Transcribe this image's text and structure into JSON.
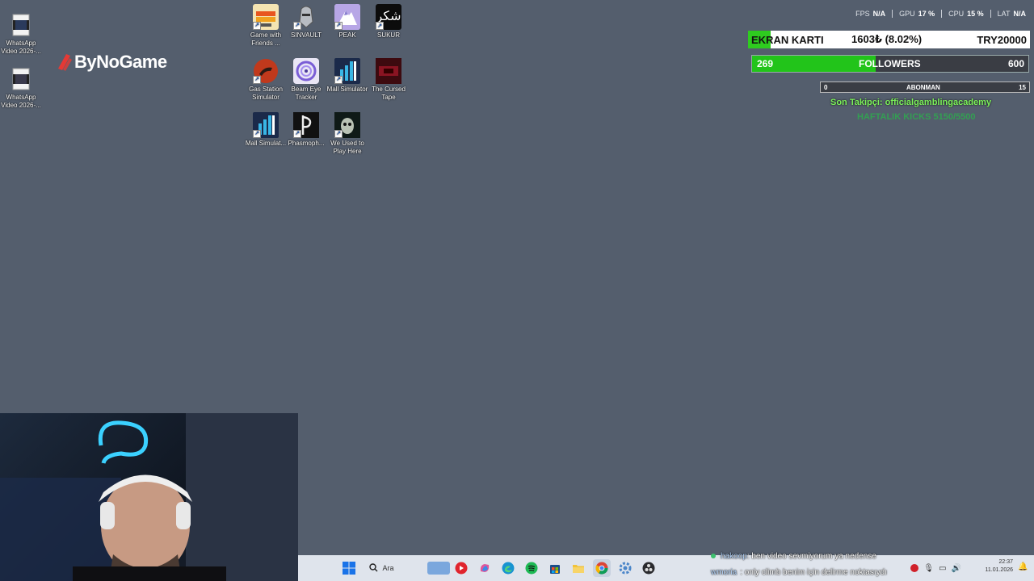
{
  "desktop_icons": [
    {
      "label": "WhatsApp Video 2026-...",
      "icon": "video-file-icon"
    },
    {
      "label": "WhatsApp Video 2026-...",
      "icon": "video-file-icon"
    },
    {
      "label": "Game with Friends ...",
      "icon": "game-icon"
    },
    {
      "label": "SINVAULT",
      "icon": "knight-helmet-icon"
    },
    {
      "label": "PEAK",
      "icon": "mountain-icon"
    },
    {
      "label": "SUKUR",
      "icon": "arabic-text-icon"
    },
    {
      "label": "Gas Station Simulator",
      "icon": "gas-station-icon"
    },
    {
      "label": "Beam Eye Tracker",
      "icon": "eye-spiral-icon"
    },
    {
      "label": "Mall Simulator",
      "icon": "mall-icon"
    },
    {
      "label": "The Cursed Tape",
      "icon": "red-tape-icon"
    },
    {
      "label": "Mall Simulat...",
      "icon": "mall-icon"
    },
    {
      "label": "Phasmoph...",
      "icon": "phasmophobia-icon"
    },
    {
      "label": "We Used to Play Here",
      "icon": "ghost-face-icon"
    }
  ],
  "sukur_glyph": "شكر",
  "logo": {
    "text": "ByNoGame"
  },
  "stats": [
    {
      "label": "FPS",
      "value": "N/A"
    },
    {
      "label": "GPU",
      "value": "17 %"
    },
    {
      "label": "CPU",
      "value": "15 %"
    },
    {
      "label": "LAT",
      "value": "N/A"
    }
  ],
  "gpu_widget": {
    "label": "EKRAN KARTI",
    "price": "1603₺ (8.02%)",
    "goal": "TRY20000",
    "progress": 0.0802
  },
  "followers": {
    "current": "269",
    "label": "FOLLOWERS",
    "goal": "600",
    "progress": 0.448
  },
  "subscribers": {
    "current": "0",
    "label": "ABONMAN",
    "goal": "15"
  },
  "last_follower": "Son Takipçi: officialgamblingacademy",
  "weekly_kicks": "HAFTALIK KICKS 5150/5500",
  "taskbar": {
    "search_placeholder": "Ara"
  },
  "chat": [
    {
      "user": "hakoop",
      "message": ": ben video sevmiyorum ya nedense"
    },
    {
      "user": "wmoria",
      "message": ": only climb benim için delirme noktasıydı"
    }
  ],
  "clock": {
    "time": "22:37",
    "date": "11.01.2026"
  },
  "colors": {
    "accent_green": "#2ecc1f",
    "follower_text": "#7cf25a",
    "desktop_bg": "#545e6d"
  }
}
